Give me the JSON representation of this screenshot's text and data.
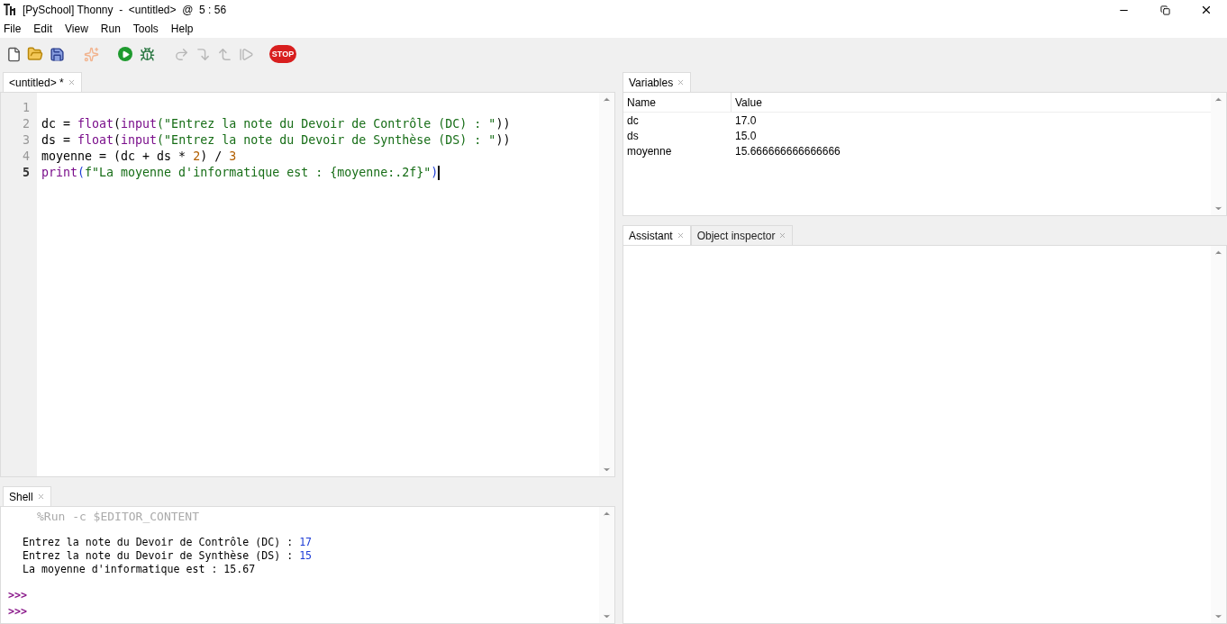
{
  "window": {
    "title": "[PySchool] Thonny  -  <untitled>  @  5 : 56"
  },
  "menu": [
    "File",
    "Edit",
    "View",
    "Run",
    "Tools",
    "Help"
  ],
  "toolbar": [
    {
      "kind": "new",
      "disabled": false
    },
    {
      "kind": "open",
      "disabled": false
    },
    {
      "kind": "save",
      "disabled": false
    },
    {
      "kind": "gap"
    },
    {
      "kind": "sparkle",
      "disabled": true
    },
    {
      "kind": "gap"
    },
    {
      "kind": "run",
      "disabled": false
    },
    {
      "kind": "debug",
      "disabled": false
    },
    {
      "kind": "gap"
    },
    {
      "kind": "step_over",
      "disabled": true
    },
    {
      "kind": "step_into",
      "disabled": true
    },
    {
      "kind": "step_out",
      "disabled": true
    },
    {
      "kind": "resume",
      "disabled": true
    },
    {
      "kind": "gap"
    },
    {
      "kind": "stop",
      "disabled": false,
      "label": "STOP"
    }
  ],
  "editor": {
    "tabs": [
      {
        "label": "<untitled> *",
        "selected": true
      }
    ],
    "lines": [
      {
        "number": "1",
        "current": false
      },
      {
        "number": "2",
        "current": false,
        "tokens": [
          {
            "text": "dc = ",
            "kind": "plain"
          },
          {
            "text": "float",
            "kind": "builtin"
          },
          {
            "text": "(",
            "kind": "plain"
          },
          {
            "text": "input",
            "kind": "builtin"
          },
          {
            "text": "(\"Entrez la note du Devoir de Contrôle (DC) : \"",
            "kind": "string"
          },
          {
            "text": "))",
            "kind": "plain"
          }
        ]
      },
      {
        "number": "3",
        "current": false,
        "tokens": [
          {
            "text": "ds = ",
            "kind": "plain"
          },
          {
            "text": "float",
            "kind": "builtin"
          },
          {
            "text": "(",
            "kind": "plain"
          },
          {
            "text": "input",
            "kind": "builtin"
          },
          {
            "text": "(\"Entrez la note du Devoir de Synthèse (DS) : \"",
            "kind": "string"
          },
          {
            "text": "))",
            "kind": "plain"
          }
        ]
      },
      {
        "number": "4",
        "current": false,
        "tokens": [
          {
            "text": "moyenne = (dc + ds * ",
            "kind": "plain"
          },
          {
            "text": "2",
            "kind": "number"
          },
          {
            "text": ") / ",
            "kind": "plain"
          },
          {
            "text": "3",
            "kind": "number"
          }
        ]
      },
      {
        "number": "5",
        "current": true,
        "tokens": [
          {
            "text": "print",
            "kind": "builtin"
          },
          {
            "text": "(",
            "kind": "bracket"
          },
          {
            "text": "f\"La moyenne d'informatique est : {moyenne:.2f}\"",
            "kind": "string"
          },
          {
            "text": ")",
            "kind": "bracket"
          }
        ]
      }
    ]
  },
  "shell": {
    "tabs": [
      {
        "label": "Shell",
        "selected": true
      }
    ],
    "command": "%Run -c $EDITOR_CONTENT",
    "output": [
      {
        "text": "Entrez la note du Devoir de Contrôle (DC) : ",
        "input": "17"
      },
      {
        "text": "Entrez la note du Devoir de Synthèse (DS) : ",
        "input": "15"
      },
      {
        "text": "La moyenne d'informatique est : 15.67"
      }
    ],
    "prompts": [
      ">>>",
      ">>>"
    ]
  },
  "variables": {
    "tabs": [
      {
        "label": "Variables",
        "selected": true
      }
    ],
    "columns": [
      "Name",
      "Value"
    ],
    "rows": [
      {
        "name": "dc",
        "value": "17.0"
      },
      {
        "name": "ds",
        "value": "15.0"
      },
      {
        "name": "moyenne",
        "value": "15.666666666666666"
      }
    ]
  },
  "assistant": {
    "tabs": [
      {
        "label": "Assistant",
        "selected": true
      },
      {
        "label": "Object inspector",
        "selected": false
      }
    ]
  }
}
